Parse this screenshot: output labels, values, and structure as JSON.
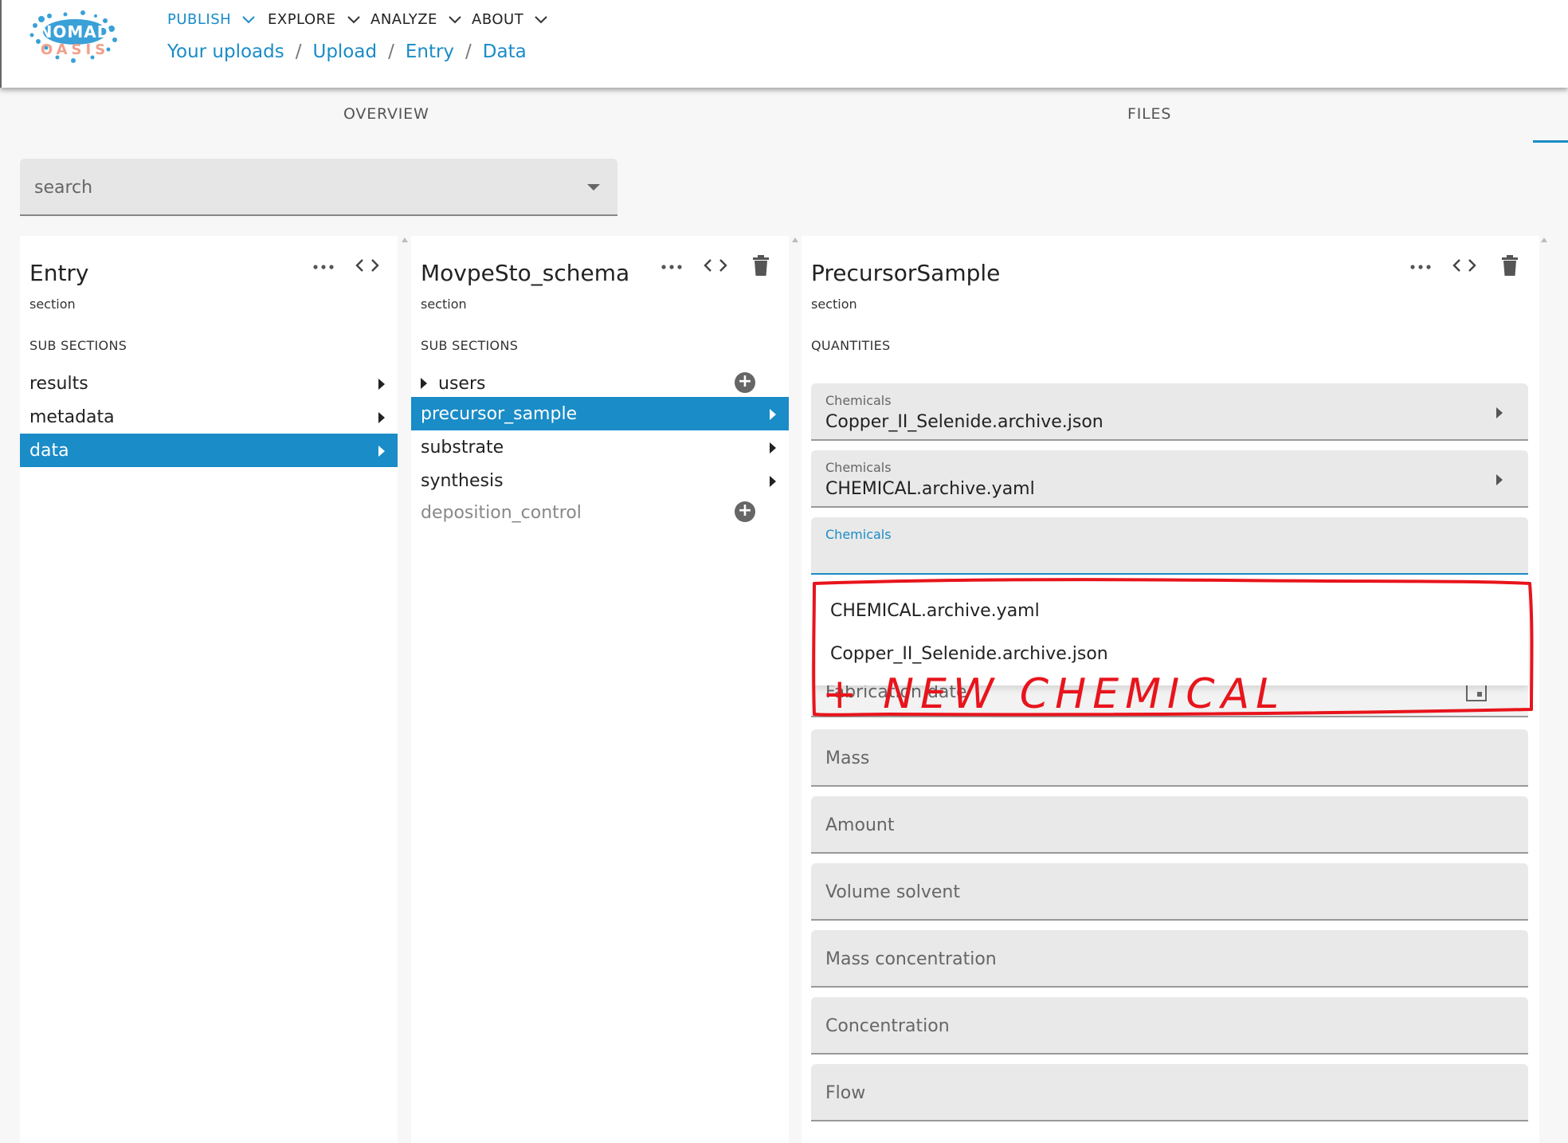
{
  "header": {
    "logo_text": "NOMAD OASIS",
    "nav": [
      {
        "label": "PUBLISH"
      },
      {
        "label": "EXPLORE"
      },
      {
        "label": "ANALYZE"
      },
      {
        "label": "ABOUT"
      }
    ],
    "breadcrumb": [
      "Your uploads",
      "Upload",
      "Entry",
      "Data"
    ]
  },
  "tabs": [
    "OVERVIEW",
    "FILES"
  ],
  "search": {
    "placeholder": "search",
    "value": ""
  },
  "panes": {
    "entry": {
      "title": "Entry",
      "subtitle": "section",
      "caption": "SUB SECTIONS",
      "items": [
        "results",
        "metadata",
        "data"
      ]
    },
    "schema": {
      "title": "MovpeSto_schema",
      "subtitle": "section",
      "caption": "SUB SECTIONS",
      "items": [
        "users",
        "precursor_sample",
        "substrate",
        "synthesis",
        "deposition_control"
      ]
    },
    "precursor": {
      "title": "PrecursorSample",
      "subtitle": "section",
      "caption": "QUANTITIES",
      "fields": [
        {
          "label": "Chemicals",
          "value": "Copper_II_Selenide.archive.json"
        },
        {
          "label": "Chemicals",
          "value": "CHEMICAL.archive.yaml"
        },
        {
          "label": "Chemicals",
          "value": ""
        },
        {
          "label": "Fabrication date"
        },
        {
          "label": "Mass"
        },
        {
          "label": "Amount"
        },
        {
          "label": "Volume solvent"
        },
        {
          "label": "Mass concentration"
        },
        {
          "label": "Concentration"
        },
        {
          "label": "Flow"
        }
      ]
    }
  },
  "dropdown": {
    "options": [
      "CHEMICAL.archive.yaml",
      "Copper_II_Selenide.archive.json"
    ]
  },
  "annotation": {
    "text": "+ NEW CHEMICAL",
    "color": "#e8141c"
  },
  "colors": {
    "accent": "#1a8cc7"
  }
}
